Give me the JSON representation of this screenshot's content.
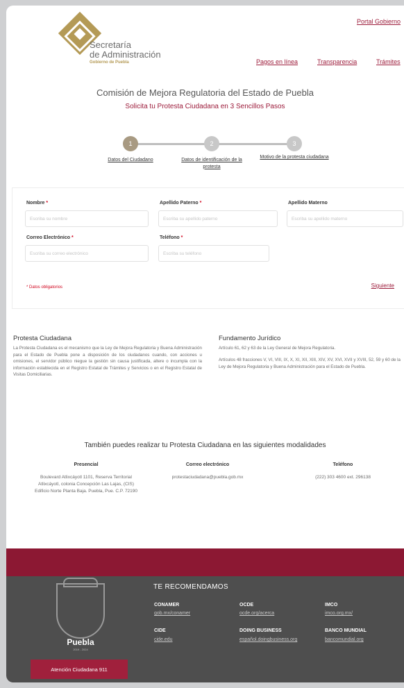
{
  "header": {
    "brand_line1": "Secretaría",
    "brand_line2": "de Administración",
    "brand_line3": "Gobierno de Puebla",
    "portal_link": "Portal Gobierno",
    "nav": [
      "Pagos en línea",
      "Transparencia",
      "Trámites"
    ]
  },
  "hero": {
    "title": "Comisión de Mejora Regulatoria del Estado de Puebla",
    "subtitle": "Solicita tu Protesta Ciudadana en 3 Sencillos Pasos"
  },
  "steps": [
    {
      "num": "1",
      "label": "Datos del Ciudadano",
      "active": true
    },
    {
      "num": "2",
      "label": "Datos de identificación de la protesta",
      "active": false
    },
    {
      "num": "3",
      "label": "Motivo de la protesta ciudadana",
      "active": false
    }
  ],
  "form": {
    "nombre_label": "Nombre",
    "nombre_placeholder": "Escriba su nombre",
    "paterno_label": "Apellido Paterno",
    "paterno_placeholder": "Escriba su apellido paterno",
    "materno_label": "Apellido Materno",
    "materno_placeholder": "Escriba su apellido materno",
    "correo_label": "Correo Electrónico",
    "correo_placeholder": "Escriba su correo electrónico",
    "telefono_label": "Teléfono",
    "telefono_placeholder": "Escriba su teléfono",
    "required_mark": "*",
    "required_note": "* Datos obligatorios",
    "next_label": "Siguiente"
  },
  "info": {
    "protesta_title": "Protesta Ciudadana",
    "protesta_text": "La Protesta Ciudadana es el mecanismo que la Ley de Mejora Regulatoria y Buena Administración para el Estado de Puebla pone a disposición de los ciudadanos cuando, con acciones u omisiones, el servidor público niegue la gestión sin causa justificada, altere o incumpla con la información establecida en el Registro Estatal de Trámites y Servicios o en el Registro Estatal de Visitas Domiciliarias.",
    "fundamento_title": "Fundamento Jurídico",
    "fundamento_p1": "Artículo 61, 62 y 63 de la Ley General de Mejora Regulatoria.",
    "fundamento_p2": "Artículos 48 fracciones V, VI, VIII, IX, X, XI, XII, XIII, XIV, XV, XVI, XVII y XVIII, 52, 59 y 60 de la Ley de Mejora Regulatoria y Buena Administración para el Estado de Puebla."
  },
  "modalidades": {
    "title": "También puedes realizar tu Protesta Ciudadana en las siguientes modalidades",
    "presencial_title": "Presencial",
    "presencial_text": "Boulevard Atlixcáyotl 1101, Reserva Territorial Atlixcáyotl, colonia Concepción Las Lajas, (CIS) Edificio Norte Planta Baja. Puebla, Pue. C.P. 72190",
    "correo_title": "Correo electrónico",
    "correo_text": "protestaciudadana@puebla.gob.mx",
    "telefono_title": "Teléfono",
    "telefono_text": "(222) 303 4600 ext. 296138"
  },
  "footer": {
    "puebla_label": "Puebla",
    "puebla_years": "2019 - 2024",
    "atencion_button": "Atención Ciudadana 911",
    "rec_title": "TE RECOMENDAMOS",
    "recs": [
      {
        "name": "CONAMER",
        "link": "gob.mx/conamer"
      },
      {
        "name": "OCDE",
        "link": "ocde.org/acerca"
      },
      {
        "name": "IMCO",
        "link": "imco.org.mx/"
      },
      {
        "name": "CIDE",
        "link": "cide.edu"
      },
      {
        "name": "DOING BUSINESS",
        "link": "español.doingbusiness.org"
      },
      {
        "name": "BANCO MUNDIAL",
        "link": "bancomundial.org"
      }
    ]
  },
  "colors": {
    "brand": "#9c1b3a",
    "gold": "#b49a56",
    "footer_bg": "#4e4e4e",
    "band": "#8c1833"
  }
}
